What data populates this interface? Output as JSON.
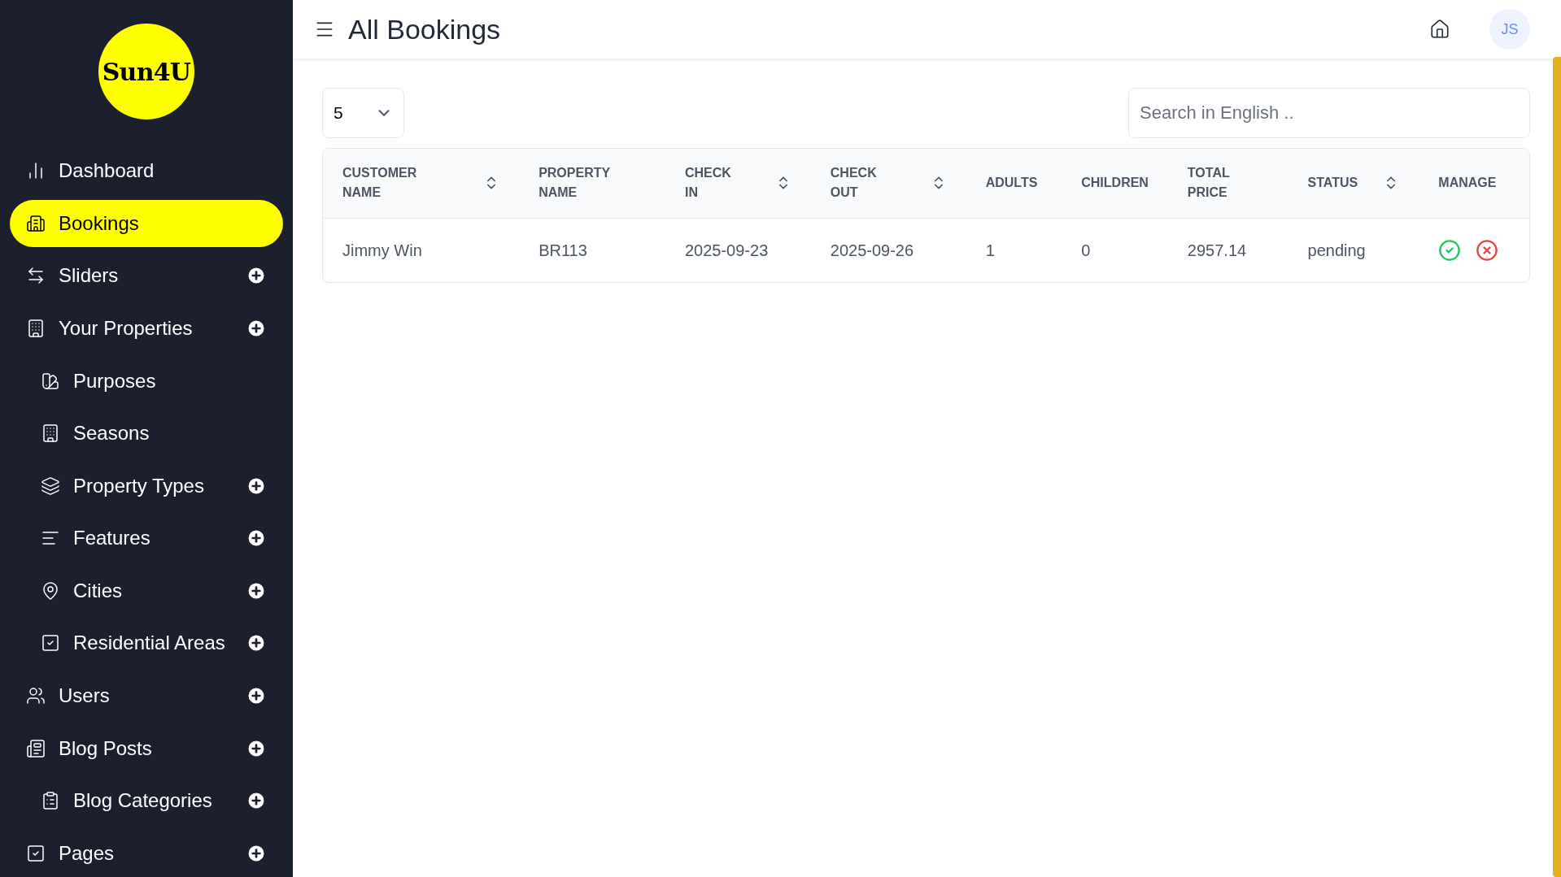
{
  "sidebar": {
    "logo": "Sun4U",
    "items": [
      {
        "label": "Dashboard",
        "selected": false,
        "add": false
      },
      {
        "label": "Bookings",
        "selected": true,
        "add": false
      },
      {
        "label": "Sliders",
        "selected": false,
        "add": true
      },
      {
        "label": "Your Properties",
        "selected": false,
        "add": true,
        "children": [
          {
            "label": "Purposes",
            "selected": false,
            "add": false
          },
          {
            "label": "Seasons",
            "selected": false,
            "add": false
          },
          {
            "label": "Property Types",
            "selected": false,
            "add": true
          },
          {
            "label": "Features",
            "selected": false,
            "add": true
          },
          {
            "label": "Cities",
            "selected": false,
            "add": true
          },
          {
            "label": "Residential Areas",
            "selected": false,
            "add": true
          }
        ]
      },
      {
        "label": "Users",
        "selected": false,
        "add": true
      },
      {
        "label": "Blog Posts",
        "selected": false,
        "add": true,
        "children": [
          {
            "label": "Blog Categories",
            "selected": false,
            "add": true
          }
        ]
      },
      {
        "label": "Pages",
        "selected": false,
        "add": true
      }
    ]
  },
  "header": {
    "title": "All Bookings",
    "avatar": "JS"
  },
  "page_size": {
    "value": "5"
  },
  "search": {
    "placeholder": "Search in English .."
  },
  "table": {
    "columns": [
      {
        "label": "CUSTOMER NAME",
        "sortable": true
      },
      {
        "label": "PROPERTY NAME",
        "sortable": false
      },
      {
        "label": "CHECK IN",
        "sortable": true
      },
      {
        "label": "CHECK OUT",
        "sortable": true
      },
      {
        "label": "ADULTS",
        "sortable": false
      },
      {
        "label": "CHILDREN",
        "sortable": false
      },
      {
        "label": "TOTAL PRICE",
        "sortable": false
      },
      {
        "label": "STATUS",
        "sortable": true
      },
      {
        "label": "MANAGE",
        "sortable": false
      }
    ],
    "rows": [
      {
        "cells": [
          "Jimmy Win",
          "BR113",
          "2025-09-23",
          "2025-09-26",
          "1",
          "0",
          "2957.14",
          "pending"
        ]
      }
    ]
  }
}
